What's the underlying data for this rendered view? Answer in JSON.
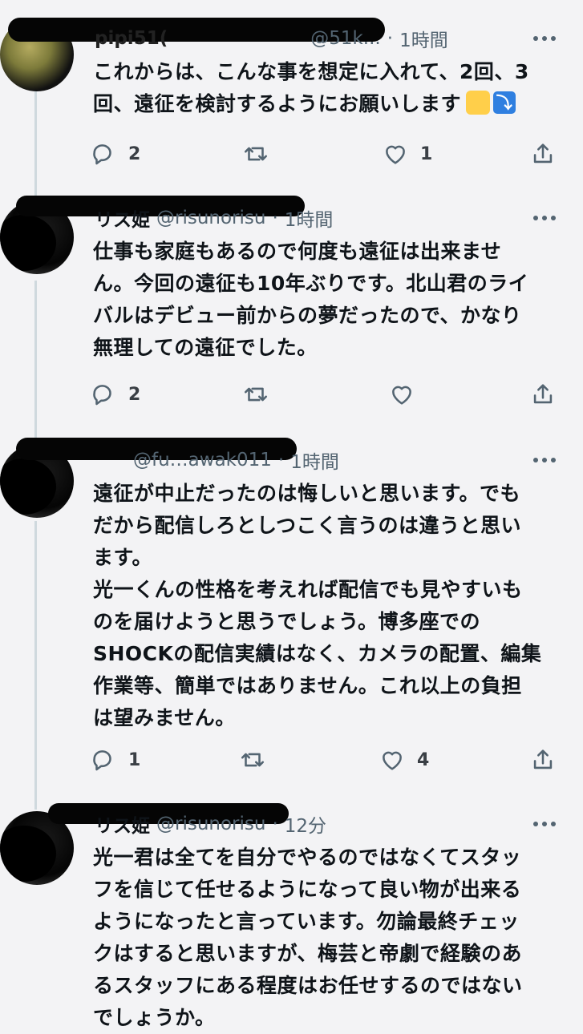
{
  "tweets": [
    {
      "name": "pipi51(",
      "handle": "@51k...",
      "time": "1時間",
      "text": "これからは、こんな事を想定に入れて、2回、3回、遠征を検討するようにお願いします",
      "emoji": [
        "person-bowing-emoji",
        "arrow-down-right-emoji"
      ],
      "replies": "2",
      "retweets": "",
      "likes": "1"
    },
    {
      "name": "リス姫",
      "handle": "@risunorisu",
      "time": "1時間",
      "text": "仕事も家庭もあるので何度も遠征は出来ません。今回の遠征も10年ぶりです。北山君のライバルはデビュー前からの夢だったので、かなり無理しての遠征でした。",
      "replies": "2",
      "retweets": "",
      "likes": ""
    },
    {
      "name": "",
      "handle": "@fu…awak011",
      "time": "1時間",
      "text": "遠征が中止だったのは悔しいと思います。でもだから配信しろとしつこく言うのは違うと思います。\n光一くんの性格を考えれば配信でも見やすいものを届けようと思うでしょう。博多座でのSHOCKの配信実績はなく、カメラの配置、編集作業等、簡単ではありません。これ以上の負担は望みません。",
      "replies": "1",
      "retweets": "",
      "likes": "4"
    },
    {
      "name": "リス姫",
      "handle": "@risunorisu",
      "time": "12分",
      "text": "光一君は全てを自分でやるのではなくてスタッフを信じて任せるようになって良い物が出来るようになったと言っています。勿論最終チェックはすると思いますが、梅芸と帝劇で経験のあるスタッフにある程度はお任せするのではないでしょうか。"
    }
  ],
  "texts_lines": {
    "t0": "これからは、こんな事を想定に入れて、2回、3\n回、遠征を検討するようにお願いします",
    "t1": "仕事も家庭もあるので何度も遠征は出来ませ\nん。今回の遠征も10年ぶりです。北山君のライ\nバルはデビュー前からの夢だったので、かなり\n無理しての遠征でした。",
    "t2": "遠征が中止だったのは悔しいと思います。でも\nだから配信しろとしつこく言うのは違うと思い\nます。\n光一くんの性格を考えれば配信でも見やすいも\nのを届けようと思うでしょう。博多座での\nSHOCKの配信実績はなく、カメラの配置、編集\n作業等、簡単ではありません。これ以上の負担\nは望みません。",
    "t3": "光一君は全てを自分でやるのではなくてスタッ\nフを信じて任せるようになって良い物が出来る\nようになったと言っています。勿論最終チェッ\nクはすると思いますが、梅芸と帝劇で経験のあ\nるスタッフにある程度はお任せするのではない\nでしょうか。"
  },
  "colors": {
    "background": "#f3f3f5",
    "text": "#0f1419",
    "secondary": "#536471",
    "thread_line": "#cfd9de"
  }
}
